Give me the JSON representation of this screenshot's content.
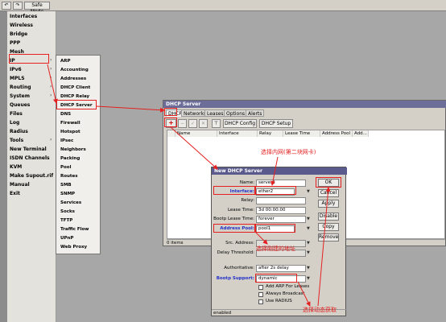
{
  "toolbar": {
    "safe_mode_label": "Safe Mode"
  },
  "left_menu": {
    "items": [
      "Interfaces",
      "Wireless",
      "Bridge",
      "PPP",
      "Mesh",
      "IP",
      "IPv6",
      "MPLS",
      "Routing",
      "System",
      "Queues",
      "Files",
      "Log",
      "Radius",
      "Tools",
      "New Terminal",
      "ISDN Channels",
      "KVM",
      "Make Supout.rif",
      "Manual",
      "Exit"
    ]
  },
  "ip_submenu": {
    "items": [
      "ARP",
      "Accounting",
      "Addresses",
      "DHCP Client",
      "DHCP Relay",
      "DHCP Server",
      "DNS",
      "Firewall",
      "Hotspot",
      "IPsec",
      "Neighbors",
      "Packing",
      "Pool",
      "Routes",
      "SMB",
      "SNMP",
      "Services",
      "Socks",
      "TFTP",
      "Traffic Flow",
      "UPnP",
      "Web Proxy"
    ]
  },
  "dhcp_window": {
    "title": "DHCP Server",
    "tabs": [
      "DHCP",
      "Networks",
      "Leases",
      "Options",
      "Alerts"
    ],
    "add_label": "+",
    "filter_label": "⊤",
    "dhcp_config_label": "DHCP Config",
    "dhcp_setup_label": "DHCP Setup",
    "columns": [
      "Name",
      "Interface",
      "Relay",
      "Lease Time",
      "Address Pool",
      "Add..."
    ],
    "status": "0 items"
  },
  "new_dialog": {
    "title": "New DHCP Server",
    "name_label": "Name:",
    "name_value": "server1",
    "interface_label": "Interface:",
    "interface_value": "ether2",
    "relay_label": "Relay:",
    "relay_value": "",
    "lease_time_label": "Lease Time:",
    "lease_time_value": "3d 00:00:00",
    "bootp_lease_label": "Bootp Lease Time:",
    "bootp_lease_value": "forever",
    "address_pool_label": "Address Pool:",
    "address_pool_value": "pool1",
    "src_address_label": "Src. Address:",
    "src_address_value": "",
    "delay_label": "Delay Threshold:",
    "delay_value": "",
    "authoritative_label": "Authoritative:",
    "authoritative_value": "after 2s delay",
    "bootp_support_label": "Bootp Support:",
    "bootp_support_value": "dynamic",
    "add_arp_label": "Add ARP For Leases",
    "always_broadcast_label": "Always Broadcast",
    "use_radius_label": "Use RADIUS",
    "status": "enabled",
    "buttons": [
      "OK",
      "Cancel",
      "Apply",
      "Disable",
      "Copy",
      "Remove"
    ]
  },
  "annotations": {
    "interface_note": "选择内网(第二块网卡)",
    "pool_note": "选择刚建的地址",
    "bootp_note": "选择动态获取"
  },
  "colors": {
    "annotation": "#e42020",
    "blue_label": "#2230c8",
    "title_bar": "#6d6d9a"
  }
}
